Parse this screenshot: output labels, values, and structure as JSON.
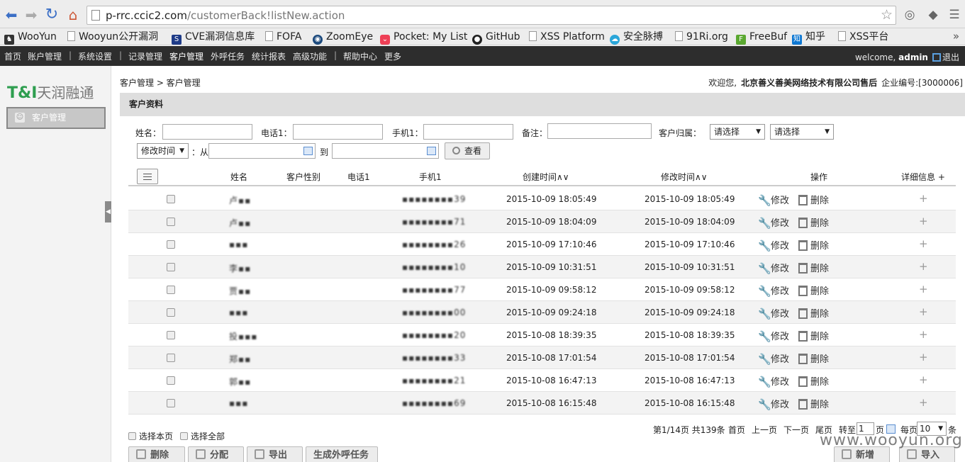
{
  "browser": {
    "url_host": "p-rrc.ccic2.com",
    "url_path": "/customerBack!listNew.action",
    "bookmarks": [
      "WooYun",
      "Wooyun公开漏洞",
      "CVE漏洞信息库",
      "FOFA",
      "ZoomEye",
      "Pocket: My List",
      "GitHub",
      "XSS Platform",
      "安全脉搏",
      "91Ri.org",
      "FreeBuf",
      "知乎",
      "XSS平台"
    ],
    "bookmarks_more": "»"
  },
  "topnav": {
    "items": [
      "首页",
      "账户管理",
      "|",
      "系统设置",
      "|",
      "记录管理",
      "客户管理",
      "外呼任务",
      "统计报表",
      "高级功能",
      "|",
      "帮助中心",
      "更多"
    ],
    "welcome": "welcome,",
    "user": "admin",
    "logout": "退出"
  },
  "sidebar": {
    "logo_mark": "T&I",
    "logo_text": "天润融通",
    "item": "客户管理"
  },
  "header": {
    "breadcrumb": "客户管理 > 客户管理",
    "welcome": "欢迎您,",
    "company": "北京善义善美网络技术有限公司售后",
    "company_code": "企业编号:[3000006]"
  },
  "panel_title": "客户资料",
  "filters": {
    "name_label": "姓名：",
    "phone1_label": "电话1：",
    "mobile1_label": "手机1：",
    "note_label": "备注：",
    "owner_label": "客户归属：",
    "owner_select1": "请选择",
    "owner_select2": "请选择",
    "time_select": "修改时间",
    "from_label": "：从",
    "to_label": "到",
    "search_button": "查看"
  },
  "table": {
    "headers": [
      "姓名",
      "客户性别",
      "电话1",
      "手机1",
      "创建时间∧∨",
      "修改时间∧∨",
      "操作",
      "详细信息 +"
    ],
    "edit_label": "修改",
    "delete_label": "删除",
    "detail_symbol": "+",
    "rows": [
      {
        "name": "卢▪▪",
        "mobile": "▪▪▪▪▪▪▪▪39",
        "created": "2015-10-09 18:05:49",
        "modified": "2015-10-09 18:05:49"
      },
      {
        "name": "卢▪▪",
        "mobile": "▪▪▪▪▪▪▪▪71",
        "created": "2015-10-09 18:04:09",
        "modified": "2015-10-09 18:04:09"
      },
      {
        "name": "▪▪▪",
        "mobile": "▪▪▪▪▪▪▪▪26",
        "created": "2015-10-09 17:10:46",
        "modified": "2015-10-09 17:10:46"
      },
      {
        "name": "李▪▪",
        "mobile": "▪▪▪▪▪▪▪▪10",
        "created": "2015-10-09 10:31:51",
        "modified": "2015-10-09 10:31:51"
      },
      {
        "name": "贾▪▪",
        "mobile": "▪▪▪▪▪▪▪▪77",
        "created": "2015-10-09 09:58:12",
        "modified": "2015-10-09 09:58:12"
      },
      {
        "name": "▪▪▪",
        "mobile": "▪▪▪▪▪▪▪▪00",
        "created": "2015-10-09 09:24:18",
        "modified": "2015-10-09 09:24:18"
      },
      {
        "name": "投▪▪▪",
        "mobile": "▪▪▪▪▪▪▪▪20",
        "created": "2015-10-08 18:39:35",
        "modified": "2015-10-08 18:39:35"
      },
      {
        "name": "郑▪▪",
        "mobile": "▪▪▪▪▪▪▪▪33",
        "created": "2015-10-08 17:01:54",
        "modified": "2015-10-08 17:01:54"
      },
      {
        "name": "郭▪▪",
        "mobile": "▪▪▪▪▪▪▪▪21",
        "created": "2015-10-08 16:47:13",
        "modified": "2015-10-08 16:47:13"
      },
      {
        "name": "▪▪▪",
        "mobile": "▪▪▪▪▪▪▪▪69",
        "created": "2015-10-08 16:15:48",
        "modified": "2015-10-08 16:15:48"
      }
    ]
  },
  "footer": {
    "select_page": "选择本页",
    "select_all": "选择全部",
    "page_info": "第1/14页 共139条",
    "first": "首页",
    "prev": "上一页",
    "next": "下一页",
    "last": "尾页",
    "goto": "转至",
    "goto_value": "1",
    "page_suffix": "页",
    "per_page": "每页",
    "per_page_value": "10",
    "per_page_suffix": "条"
  },
  "bottom_buttons": {
    "delete": "删除",
    "assign": "分配",
    "export": "导出",
    "gen_task": "生成外呼任务",
    "add": "新增",
    "import": "导入"
  },
  "watermark": "www.wooyun.org"
}
